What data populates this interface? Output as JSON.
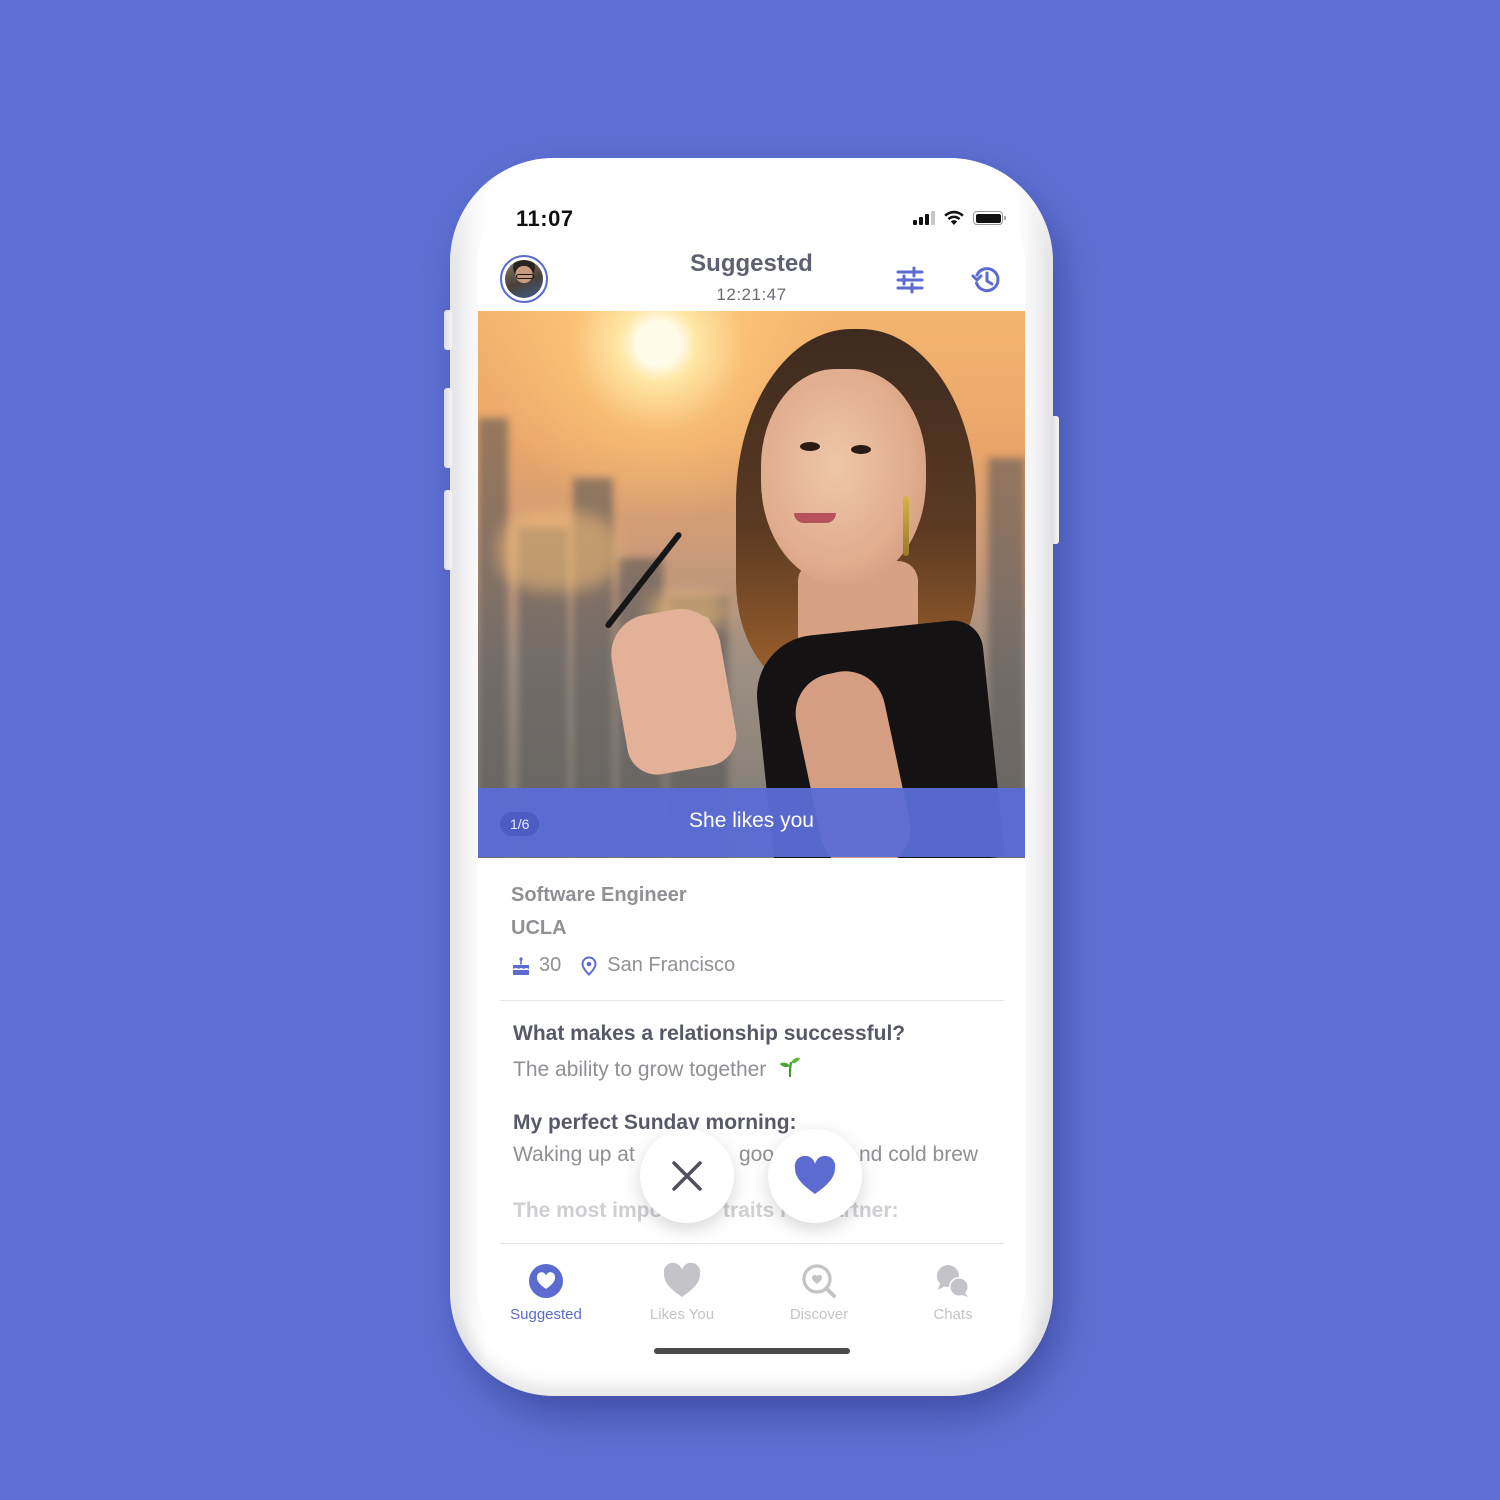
{
  "status_bar": {
    "time": "11:07",
    "signal_bars_active": 3,
    "signal_bars_total": 4,
    "wifi": "wifi-icon",
    "battery": "battery-full-icon"
  },
  "header": {
    "avatar": "user-avatar",
    "title": "Suggested",
    "subtitle": "12:21:47",
    "filter_icon": "sliders-icon",
    "history_icon": "history-icon"
  },
  "photo": {
    "counter": "1/6",
    "banner_text": "She likes you"
  },
  "profile": {
    "job": "Software Engineer",
    "school": "UCLA",
    "age": "30",
    "location": "San Francisco"
  },
  "prompts": [
    {
      "question": "What makes a relationship successful?",
      "answer": "The ability to grow together",
      "answer_emoji": "seedling"
    },
    {
      "question": "My perfect Sunday morning:",
      "answer_parts": [
        "Waking up at",
        "goo",
        "nd cold brew"
      ]
    },
    {
      "question_parts": [
        "The most impo",
        "traits i",
        "artner:"
      ]
    }
  ],
  "actions": {
    "pass_icon": "close-icon",
    "like_icon": "heart-icon"
  },
  "tabs": [
    {
      "label": "Suggested",
      "icon": "suggested-heart-icon",
      "active": true
    },
    {
      "label": "Likes You",
      "icon": "heart-icon",
      "active": false
    },
    {
      "label": "Discover",
      "icon": "discover-icon",
      "active": false
    },
    {
      "label": "Chats",
      "icon": "chats-icon",
      "active": false
    }
  ],
  "colors": {
    "accent": "#5b6bd0",
    "background": "#5d6fd2",
    "text_muted": "#909096",
    "tab_inactive": "#c4c4c8"
  }
}
